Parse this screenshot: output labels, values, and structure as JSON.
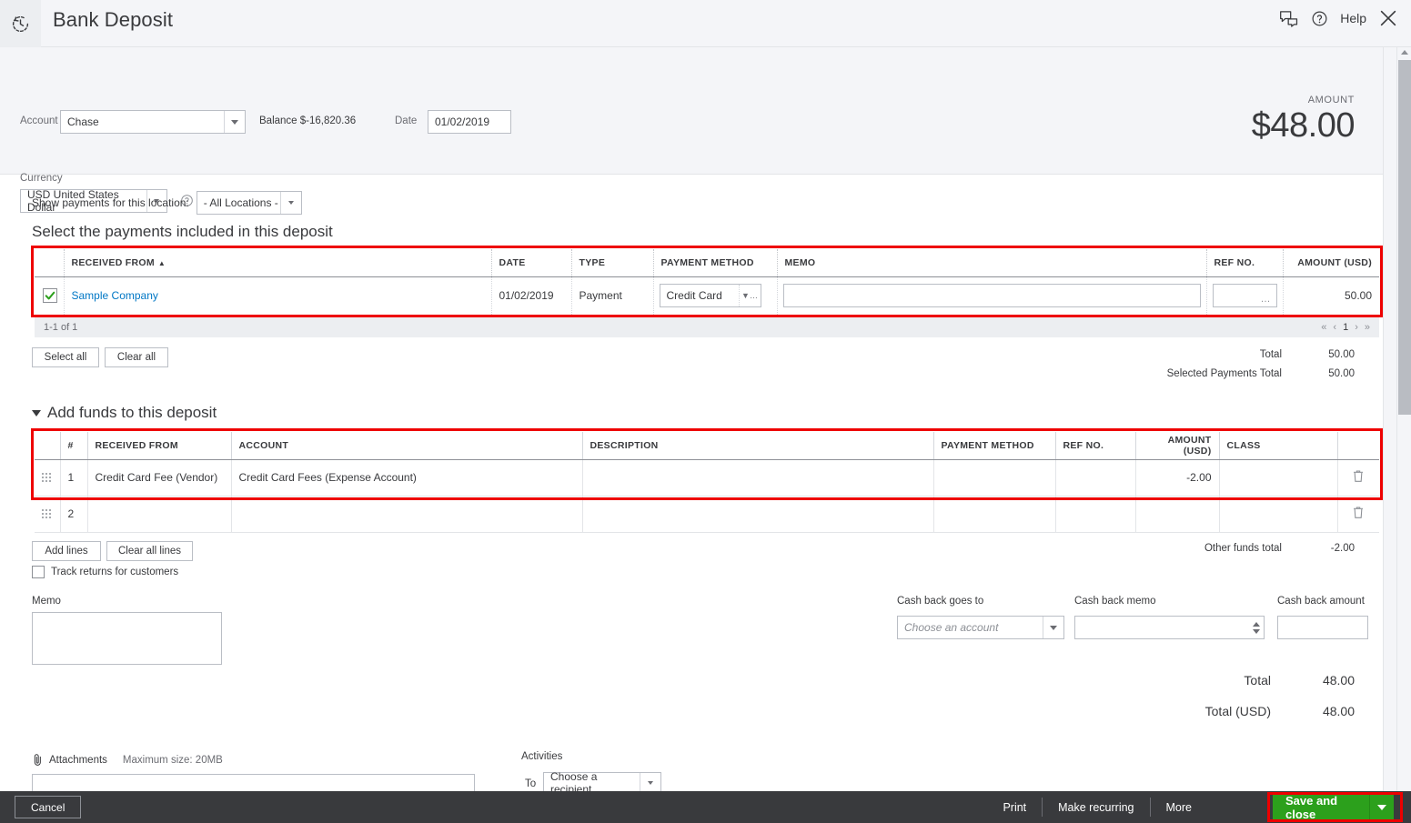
{
  "header": {
    "title": "Bank Deposit",
    "history_icon": "history-clock-icon",
    "chat_icon": "chat-bubbles-icon",
    "help_icon": "question-circle-icon",
    "help_label": "Help",
    "close_icon": "close-x-icon"
  },
  "topform": {
    "account_label": "Account",
    "account_value": "Chase",
    "balance_text": "Balance $-16,820.36",
    "date_label": "Date",
    "date_value": "01/02/2019",
    "currency_label": "Currency",
    "currency_value": "USD United States Dollar",
    "currency_help_icon": "question-circle-icon",
    "amount_label": "AMOUNT",
    "amount_value": "$48.00"
  },
  "payments": {
    "location_filter_label": "Show payments for this location:",
    "location_filter_value": "- All Locations -",
    "section_title": "Select the payments included in this deposit",
    "columns": [
      "RECEIVED FROM",
      "DATE",
      "TYPE",
      "PAYMENT METHOD",
      "MEMO",
      "REF NO.",
      "AMOUNT (USD)"
    ],
    "sort_indicator": "▲",
    "rows": [
      {
        "checked": true,
        "received_from": "Sample Company",
        "date": "01/02/2019",
        "type": "Payment",
        "payment_method": "Credit Card",
        "memo": "",
        "ref_no": "",
        "amount": "50.00"
      }
    ],
    "pagination_text": "1-1 of 1",
    "pager_first": "«",
    "pager_prev": "‹",
    "pager_page": "1",
    "pager_next": "›",
    "pager_last": "»",
    "select_all_label": "Select all",
    "clear_all_label": "Clear all",
    "total_label": "Total",
    "total_value": "50.00",
    "selected_total_label": "Selected Payments Total",
    "selected_total_value": "50.00"
  },
  "addfunds": {
    "section_title": "Add funds to this deposit",
    "columns": [
      "#",
      "RECEIVED FROM",
      "ACCOUNT",
      "DESCRIPTION",
      "PAYMENT METHOD",
      "REF NO.",
      "AMOUNT (USD)",
      "CLASS"
    ],
    "rows": [
      {
        "num": "1",
        "received_from": "Credit Card Fee (Vendor)",
        "account": "Credit Card Fees (Expense Account)",
        "description": "",
        "payment_method": "",
        "ref_no": "",
        "amount": "-2.00",
        "class": "",
        "delete_icon": "trash-icon"
      },
      {
        "num": "2",
        "received_from": "",
        "account": "",
        "description": "",
        "payment_method": "",
        "ref_no": "",
        "amount": "",
        "class": "",
        "delete_icon": "trash-icon"
      }
    ],
    "add_lines_label": "Add lines",
    "clear_all_lines_label": "Clear all lines",
    "track_returns_label": "Track returns for customers",
    "track_returns_checked": false,
    "other_funds_label": "Other funds total",
    "other_funds_value": "-2.00"
  },
  "footer_fields": {
    "memo_label": "Memo",
    "memo_value": "",
    "cashback_account_label": "Cash back goes to",
    "cashback_account_placeholder": "Choose an account",
    "cashback_memo_label": "Cash back memo",
    "cashback_memo_value": "",
    "cashback_amount_label": "Cash back amount",
    "cashback_amount_value": "",
    "total_label": "Total",
    "total_value": "48.00",
    "total_usd_label": "Total (USD)",
    "total_usd_value": "48.00"
  },
  "attachments": {
    "icon": "paperclip-icon",
    "label": "Attachments",
    "max_size_text": "Maximum size: 20MB",
    "activities_label": "Activities",
    "to_label": "To",
    "recipient_placeholder": "Choose a recipient"
  },
  "footer": {
    "cancel_label": "Cancel",
    "print_label": "Print",
    "make_recurring_label": "Make recurring",
    "more_label": "More",
    "save_label": "Save and close",
    "save_dropdown_icon": "chevron-down-icon"
  },
  "colors": {
    "accent_green": "#2ca01c",
    "link_blue": "#0077c5",
    "highlight_red": "#ee0000",
    "footer_dark": "#393a3d",
    "panel_gray": "#f4f5f8"
  }
}
